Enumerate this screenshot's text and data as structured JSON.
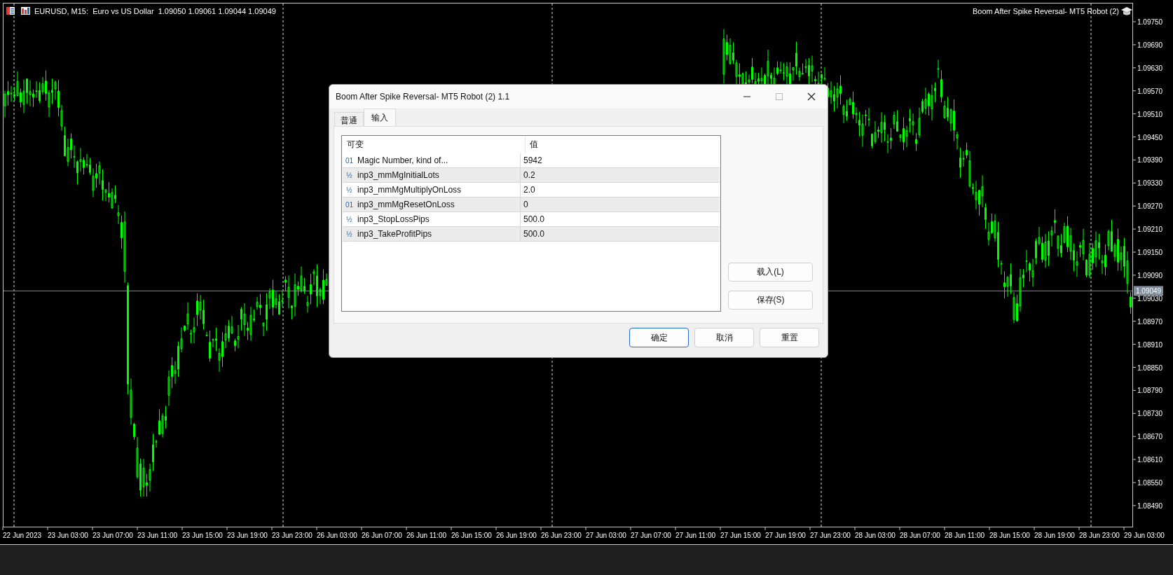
{
  "chart": {
    "caption": "EURUSD, M15:  Euro vs US Dollar  1.09050 1.09061 1.09044 1.09049",
    "expert_name": "Boom After Spike Reversal- MT5 Robot (2)",
    "price_axis": [
      "1.09750",
      "1.09690",
      "1.09630",
      "1.09570",
      "1.09510",
      "1.09450",
      "1.09390",
      "1.09330",
      "1.09270",
      "1.09210",
      "1.09150",
      "1.09090",
      "1.09030",
      "1.08970",
      "1.08910",
      "1.08850",
      "1.08790",
      "1.08730",
      "1.08670",
      "1.08610",
      "1.08550",
      "1.08490"
    ],
    "bid_price": "1.09049",
    "time_axis": [
      "22 Jun 2023",
      "23 Jun 03:00",
      "23 Jun 07:00",
      "23 Jun 11:00",
      "23 Jun 15:00",
      "23 Jun 19:00",
      "23 Jun 23:00",
      "26 Jun 03:00",
      "26 Jun 07:00",
      "26 Jun 11:00",
      "26 Jun 15:00",
      "26 Jun 19:00",
      "26 Jun 23:00",
      "27 Jun 03:00",
      "27 Jun 07:00",
      "27 Jun 11:00",
      "27 Jun 15:00",
      "27 Jun 19:00",
      "27 Jun 23:00",
      "28 Jun 03:00",
      "28 Jun 07:00",
      "28 Jun 11:00",
      "28 Jun 15:00",
      "28 Jun 19:00",
      "28 Jun 23:00",
      "29 Jun 03:00"
    ]
  },
  "dialog": {
    "title": "Boom After Spike Reversal- MT5 Robot (2) 1.1",
    "tabs": [
      {
        "label": "普通",
        "selected": false
      },
      {
        "label": "输入",
        "selected": true
      }
    ],
    "columns": [
      "可变",
      "值"
    ],
    "rows": [
      {
        "icon": "01",
        "name": "Magic Number, kind of...",
        "value": "5942"
      },
      {
        "icon": "½",
        "name": "inp3_mmMgInitialLots",
        "value": "0.2"
      },
      {
        "icon": "½",
        "name": "inp3_mmMgMultiplyOnLoss",
        "value": "2.0"
      },
      {
        "icon": "01",
        "name": "inp3_mmMgResetOnLoss",
        "value": "0"
      },
      {
        "icon": "½",
        "name": "inp3_StopLossPips",
        "value": "500.0"
      },
      {
        "icon": "½",
        "name": "inp3_TakeProfitPips",
        "value": "500.0"
      }
    ],
    "side_buttons": [
      "载入(L)",
      "保存(S)"
    ],
    "buttons": [
      {
        "label": "确定",
        "default": true
      },
      {
        "label": "取消",
        "default": false
      },
      {
        "label": "重置",
        "default": false
      }
    ]
  }
}
